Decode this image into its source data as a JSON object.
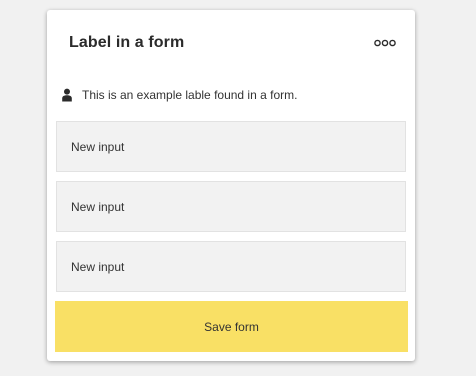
{
  "card": {
    "title": "Label in a form",
    "more_icon": "more-horizontal-icon"
  },
  "label": {
    "icon": "person-icon",
    "text": "This is an example lable found in a form."
  },
  "inputs": [
    {
      "value": "New input"
    },
    {
      "value": "New input"
    },
    {
      "value": "New input"
    }
  ],
  "save_button": {
    "label": "Save form",
    "color": "#f9e065"
  }
}
